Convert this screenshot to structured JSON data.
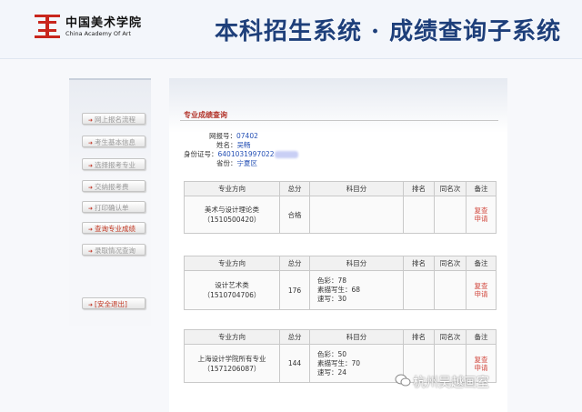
{
  "header": {
    "logo_cn": "中国美术学院",
    "logo_en": "China Academy Of Art",
    "system_title": "本科招生系统 · 成绩查询子系统"
  },
  "sidebar": {
    "items": [
      {
        "label": "网上报名流程"
      },
      {
        "label": "考生基本信息"
      },
      {
        "label": "选择报考专业"
      },
      {
        "label": "交纳报考费"
      },
      {
        "label": "打印确认单"
      },
      {
        "label": "查询专业成绩"
      },
      {
        "label": "录取情况查询"
      }
    ],
    "logout_label": "[安全退出]"
  },
  "main": {
    "section_title": "专业成绩查询",
    "info": {
      "reg_no_label": "网报号：",
      "reg_no": "07402",
      "name_label": "姓名：",
      "name": "吴畅",
      "id_label": "身份证号：",
      "id": "6401031997022",
      "province_label": "省份：",
      "province": "宁夏区"
    },
    "table_headers": [
      "专业方向",
      "总分",
      "科目分",
      "排名",
      "同名次",
      "备注"
    ],
    "records": [
      {
        "major": "美术与设计理论类",
        "code": "（1510500420）",
        "total": "合格",
        "subjects": [],
        "rank": "",
        "tie": "",
        "note_line1": "复查",
        "note_line2": "申请"
      },
      {
        "major": "设计艺术类",
        "code": "（1510704706）",
        "total": "176",
        "subjects": [
          "色彩：78",
          "素描写生：68",
          "速写：30"
        ],
        "rank": "",
        "tie": "",
        "note_line1": "复查",
        "note_line2": "申请"
      },
      {
        "major": "上海设计学院所有专业",
        "code": "（1571206087）",
        "total": "144",
        "subjects": [
          "色彩：50",
          "素描写生：70",
          "速写：24"
        ],
        "rank": "",
        "tie": "",
        "note_line1": "复查",
        "note_line2": "申请"
      }
    ]
  },
  "watermark": "杭州吴越画室",
  "colors": {
    "title_blue": "#1e3f7a",
    "accent_red": "#b2332a",
    "link_blue": "#2550b5"
  }
}
